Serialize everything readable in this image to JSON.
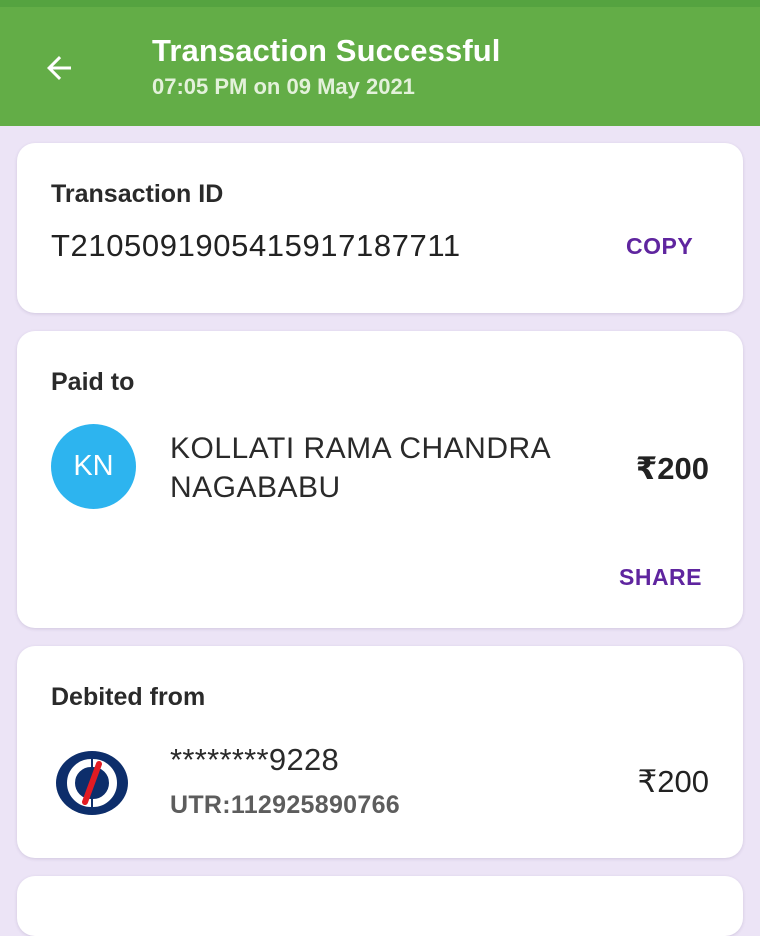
{
  "header": {
    "title": "Transaction Successful",
    "subtitle": "07:05 PM on 09 May 2021",
    "back_icon": "arrow-left-icon",
    "color": "#63ad47"
  },
  "transaction": {
    "label": "Transaction ID",
    "id": "T2105091905415917187711",
    "copy_label": "COPY"
  },
  "paid_to": {
    "label": "Paid to",
    "avatar_initials": "KN",
    "avatar_color": "#2db4ef",
    "name": "KOLLATI RAMA CHANDRA NAGABABU",
    "amount": "₹200",
    "share_label": "SHARE"
  },
  "debited_from": {
    "label": "Debited from",
    "bank_icon": "kotak-bank-logo-icon",
    "account": "********9228",
    "utr": "UTR:112925890766",
    "amount": "₹200"
  },
  "accent_color": "#5f259f"
}
